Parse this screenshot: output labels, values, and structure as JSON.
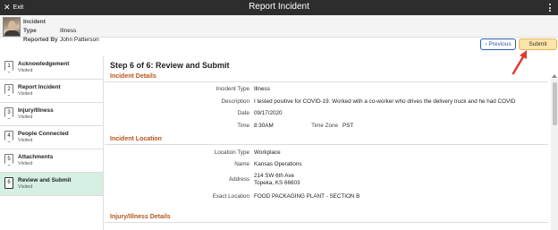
{
  "topbar": {
    "exit_label": "Exit",
    "title": "Report Incident"
  },
  "header": {
    "incident_type_label": "Incident Type",
    "incident_type_value": "Illness",
    "reported_by_label": "Reported By",
    "reported_by_value": "John Patterson"
  },
  "actions": {
    "previous_label": "Previous",
    "submit_label": "Submit"
  },
  "steps": [
    {
      "num": "1",
      "title": "Acknowledgement",
      "status": "Visited"
    },
    {
      "num": "2",
      "title": "Report Incident",
      "status": "Visited"
    },
    {
      "num": "3",
      "title": "Injury/Illness",
      "status": "Visited"
    },
    {
      "num": "4",
      "title": "People Connected",
      "status": "Visited"
    },
    {
      "num": "5",
      "title": "Attachments",
      "status": "Visited"
    },
    {
      "num": "6",
      "title": "Review and Submit",
      "status": "Visited"
    }
  ],
  "main": {
    "page_title": "Step 6 of 6: Review and Submit",
    "incident_details": {
      "title": "Incident Details",
      "incident_type_label": "Incident Type",
      "incident_type_value": "Illness",
      "description_label": "Description",
      "description_value": "I tested positive for COVID-19.  Worked with a co-worker who drives the delivery truck and he had COVID",
      "date_label": "Date",
      "date_value": "09/17/2020",
      "time_label": "Time",
      "time_value": "8:30AM",
      "timezone_label": "Time Zone",
      "timezone_value": "PST"
    },
    "incident_location": {
      "title": "Incident Location",
      "location_type_label": "Location Type",
      "location_type_value": "Workplace",
      "name_label": "Name",
      "name_value": "Kansas Operations",
      "address_label": "Address",
      "address_line1": "214 SW 6th Ave",
      "address_line2": "Topeka, KS 66603",
      "exact_location_label": "Exact Location",
      "exact_location_value": "FOOD PACKAGING PLANT - SECTION B"
    },
    "injury_details": {
      "title": "Injury/Illness Details"
    }
  },
  "colors": {
    "accent_orange": "#b5541c",
    "submit_bg": "#fde4a8",
    "active_step_bg": "#d6efe3",
    "topbar_bg": "#2d2d2d",
    "link_blue": "#2a5db0",
    "annotation_red": "#e03a2f"
  }
}
